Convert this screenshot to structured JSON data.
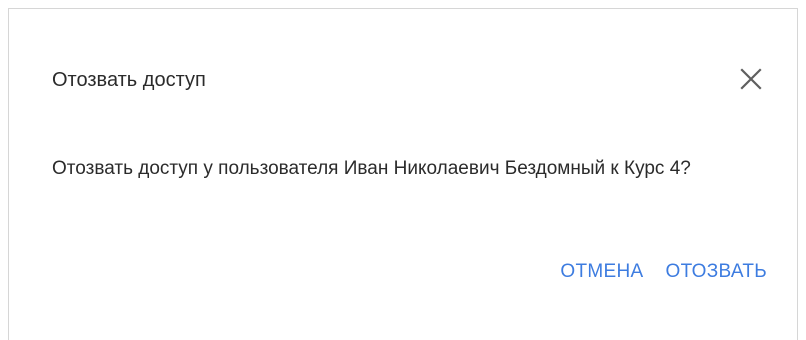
{
  "dialog": {
    "title": "Отозвать доступ",
    "message": "Отозвать доступ у пользователя Иван Николаевич Бездомный к Курс 4?",
    "cancel_label": "ОТМЕНА",
    "confirm_label": "ОТОЗВАТЬ",
    "close_icon": "close-icon"
  },
  "colors": {
    "accent": "#3d7ce0",
    "text": "#2b2b2b"
  }
}
